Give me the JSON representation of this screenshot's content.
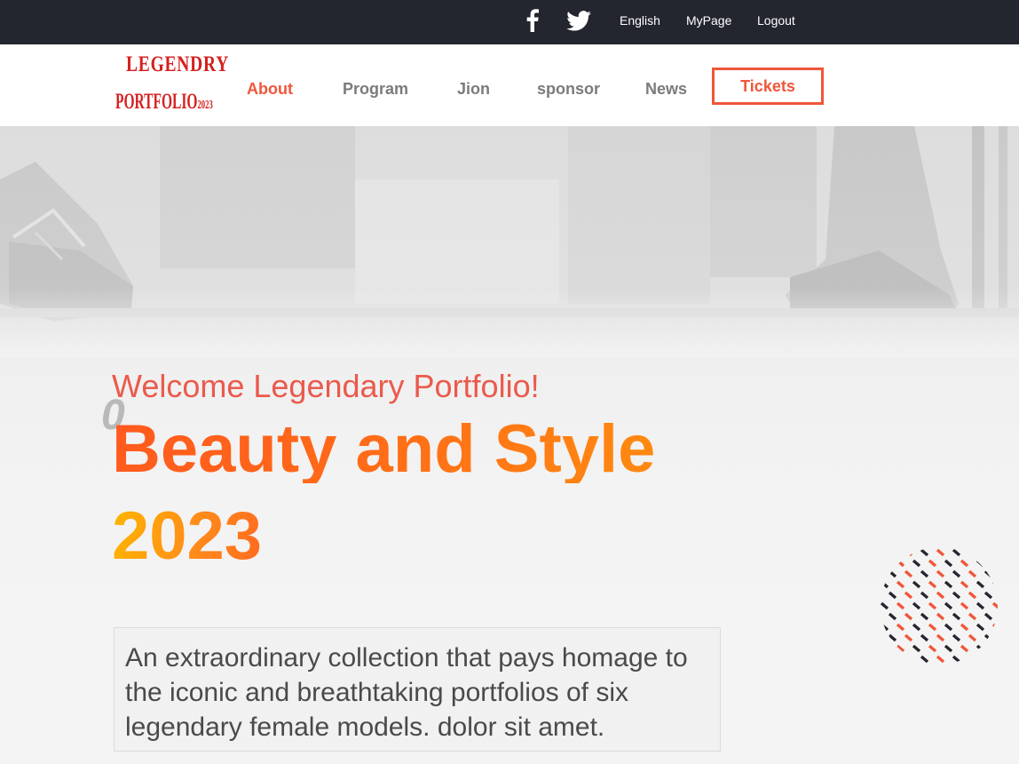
{
  "topbar": {
    "social": [
      {
        "name": "facebook-icon"
      },
      {
        "name": "twitter-icon"
      }
    ],
    "links": [
      "English",
      "MyPage",
      "Logout"
    ]
  },
  "logo": {
    "line1": "LEGENDRY",
    "line2": "PORTFOLIO",
    "line2_suffix": "2023"
  },
  "nav": {
    "items": [
      "About",
      "Program",
      "Jion",
      "sponsor",
      "News"
    ],
    "active_index": 0,
    "cta": "Tickets"
  },
  "hero": {
    "welcome": "Welcome Legendary Portfolio!",
    "ghost_char": "0",
    "headline": "Beauty and Style",
    "year": "2023",
    "description": "An extraordinary collection that pays homage to the iconic and breathtaking portfolios of six legendary female models. dolor sit amet."
  },
  "colors": {
    "accent": "#f0563a",
    "topbar_bg": "#23262f",
    "nav_text": "#7b7b7b",
    "headline_start": "#ff5a1e",
    "headline_end": "#ff8a10",
    "year_start": "#ffb500",
    "dot_red": "#f0563a",
    "dot_dark": "#23262f"
  }
}
